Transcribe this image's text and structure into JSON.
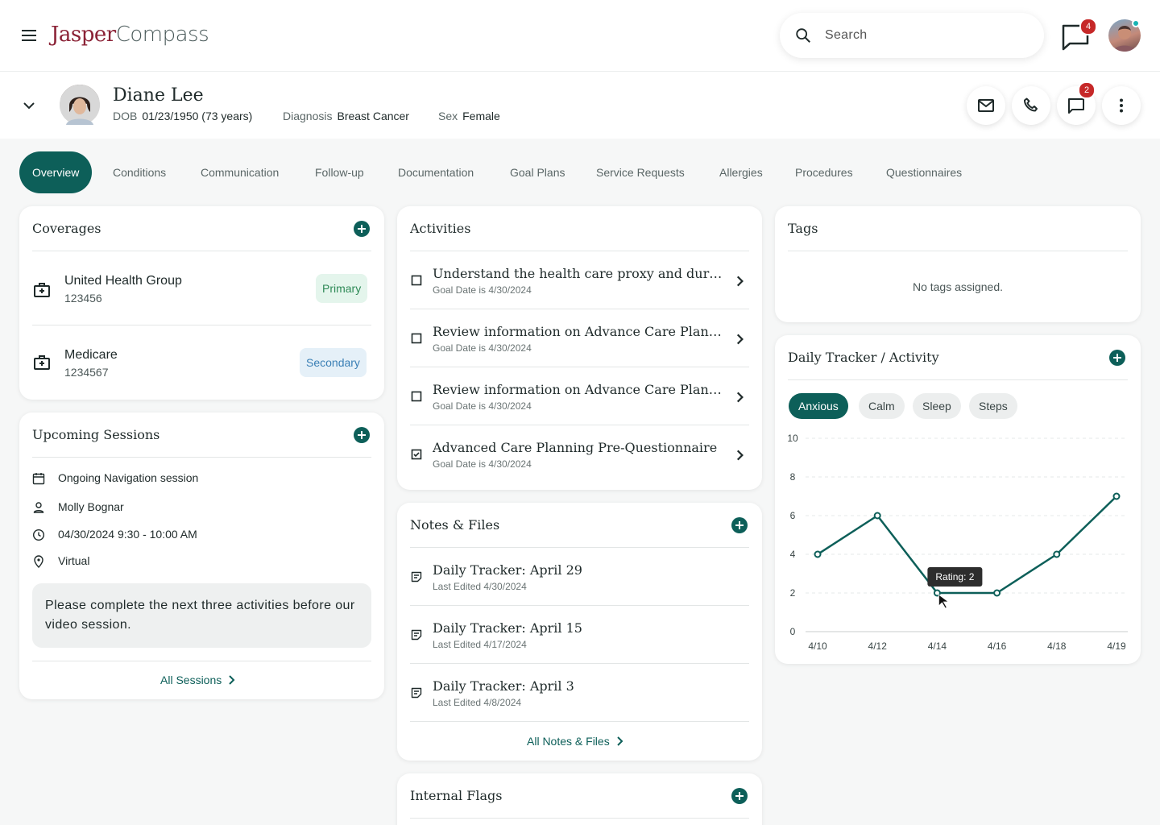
{
  "app": {
    "logo_part1": "Jasper",
    "logo_part2": "Compass"
  },
  "search": {
    "placeholder": "Search"
  },
  "topbar": {
    "messages_count": "4"
  },
  "patient": {
    "name": "Diane Lee",
    "dob_label": "DOB",
    "dob_value": "01/23/1950 (73 years)",
    "diagnosis_label": "Diagnosis",
    "diagnosis_value": "Breast Cancer",
    "sex_label": "Sex",
    "sex_value": "Female",
    "chat_count": "2"
  },
  "tabs": [
    "Overview",
    "Conditions",
    "Communication",
    "Follow-up",
    "Documentation",
    "Goal Plans",
    "Service Requests",
    "Allergies",
    "Procedures",
    "Questionnaires"
  ],
  "coverages": {
    "title": "Coverages",
    "items": [
      {
        "name": "United Health Group",
        "id": "123456",
        "badge": "Primary"
      },
      {
        "name": "Medicare",
        "id": "1234567",
        "badge": "Secondary"
      }
    ]
  },
  "sessions": {
    "title": "Upcoming Sessions",
    "type": "Ongoing Navigation session",
    "host": "Molly Bognar",
    "time": "04/30/2024 9:30 - 10:00 AM",
    "location": "Virtual",
    "note": "Please complete the next three activities before our video session.",
    "link": "All Sessions"
  },
  "activities": {
    "title": "Activities",
    "items": [
      {
        "title": "Understand the health care proxy and durable p...",
        "sub": "Goal Date is 4/30/2024",
        "checked": false
      },
      {
        "title": "Review information on Advance Care Planning",
        "sub": "Goal Date is 4/30/2024",
        "checked": false
      },
      {
        "title": "Review information on Advance Care Planning",
        "sub": "Goal Date is 4/30/2024",
        "checked": false
      },
      {
        "title": "Advanced Care Planning Pre-Questionnaire",
        "sub": "Goal Date is 4/30/2024",
        "checked": true
      }
    ]
  },
  "notes": {
    "title": "Notes & Files",
    "items": [
      {
        "title": "Daily Tracker: April 29",
        "sub": "Last Edited 4/30/2024"
      },
      {
        "title": "Daily Tracker: April 15",
        "sub": "Last Edited 4/17/2024"
      },
      {
        "title": "Daily Tracker: April 3",
        "sub": "Last Edited 4/8/2024"
      }
    ],
    "link": "All Notes & Files"
  },
  "flags": {
    "title": "Internal Flags"
  },
  "tags": {
    "title": "Tags",
    "empty": "No tags assigned."
  },
  "tracker": {
    "title": "Daily Tracker / Activity",
    "chips": [
      "Anxious",
      "Calm",
      "Sleep",
      "Steps"
    ],
    "tooltip": "Rating: 2"
  },
  "chart_data": {
    "type": "line",
    "x": [
      "4/10",
      "4/12",
      "4/14",
      "4/16",
      "4/18",
      "4/19"
    ],
    "values": [
      4,
      6,
      2,
      2,
      4,
      7
    ],
    "ylim": [
      0,
      10
    ],
    "yticks": [
      0,
      2,
      4,
      6,
      8,
      10
    ],
    "grid": true,
    "color": "#0d5f59"
  }
}
